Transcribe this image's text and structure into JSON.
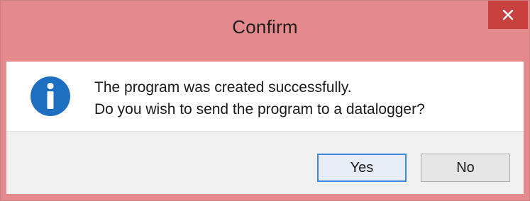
{
  "dialog": {
    "title": "Confirm",
    "icon": "info-icon",
    "message_lines": [
      "The program was created successfully.",
      "Do you wish to send the program to a datalogger?"
    ],
    "buttons": {
      "yes_label": "Yes",
      "no_label": "No"
    },
    "close_icon": "close-icon",
    "colors": {
      "title_bar": "#e48a8d",
      "close_button": "#c7413f",
      "info_icon": "#1e6fc2",
      "button_area": "#f0f0f0",
      "default_button_border": "#3c8ae0"
    }
  }
}
